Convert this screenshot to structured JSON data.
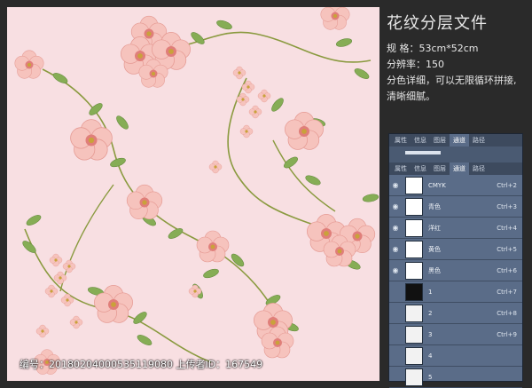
{
  "title": "花纹分层文件",
  "specs": [
    "规  格：53cm*52cm",
    "分辨率：150",
    "分色详细，可以无限循环拼接,",
    "清晰细腻。"
  ],
  "panel_top_tabs": [
    "属性",
    "信息",
    "图层",
    "通道",
    "路径"
  ],
  "panel_tabs": [
    "属性",
    "信息",
    "图层",
    "通道",
    "路径"
  ],
  "channels": [
    {
      "name": "CMYK",
      "shortcut": "Ctrl+2"
    },
    {
      "name": "青色",
      "shortcut": "Ctrl+3"
    },
    {
      "name": "洋红",
      "shortcut": "Ctrl+4"
    },
    {
      "name": "黄色",
      "shortcut": "Ctrl+5"
    },
    {
      "name": "黑色",
      "shortcut": "Ctrl+6"
    },
    {
      "name": "1",
      "shortcut": "Ctrl+7"
    },
    {
      "name": "2",
      "shortcut": "Ctrl+8"
    },
    {
      "name": "3",
      "shortcut": "Ctrl+9"
    },
    {
      "name": "4",
      "shortcut": ""
    },
    {
      "name": "5",
      "shortcut": ""
    }
  ],
  "footer": "编号：20180204000535119080 上传者ID：167549",
  "colors": {
    "pattern_bg": "#f8dfe2",
    "panel": "#5a6c88",
    "petal": "#f3b4b0",
    "leaf": "#7aa04a"
  }
}
